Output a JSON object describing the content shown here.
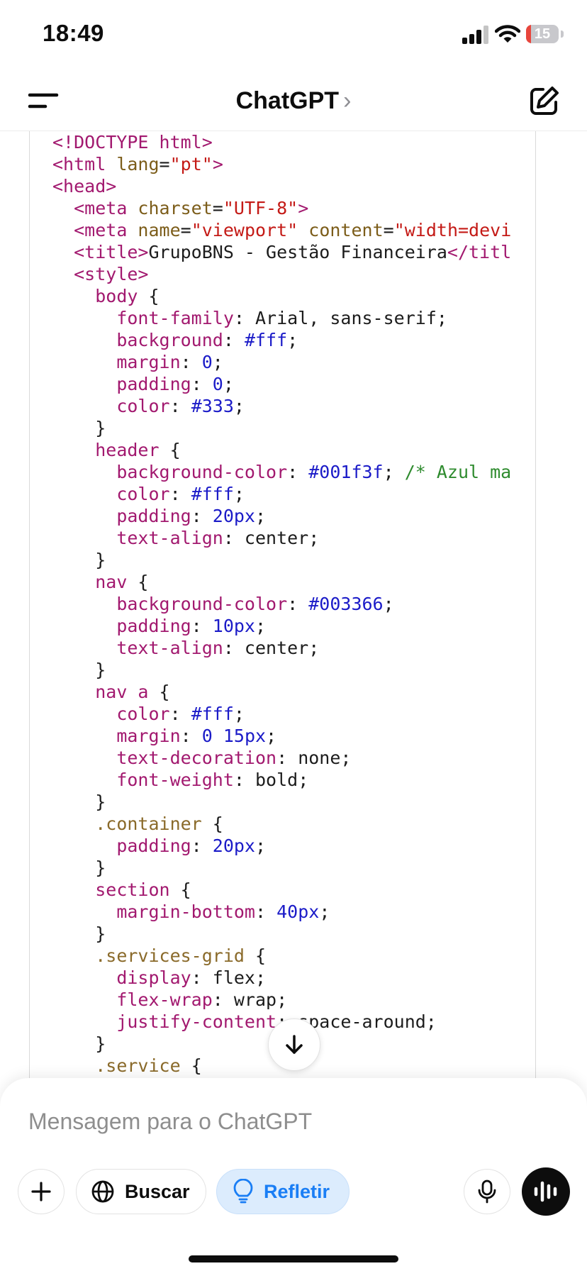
{
  "status_bar": {
    "time": "18:49",
    "battery_percent": "15",
    "battery_level": 0.15,
    "battery_color": "#e8453c",
    "icons": [
      "signal-icon",
      "wifi-icon",
      "battery-icon"
    ]
  },
  "nav": {
    "title": "ChatGPT",
    "title_chevron": "›",
    "icons": [
      "menu-icon",
      "chevron-right-icon",
      "new-chat-icon"
    ]
  },
  "code": {
    "lines": [
      [
        [
          "tag",
          "<!DOCTYPE html>"
        ]
      ],
      [
        [
          "tag",
          "<html "
        ],
        [
          "attr",
          "lang"
        ],
        [
          "plain",
          "="
        ],
        [
          "str",
          "\"pt\""
        ],
        [
          "tag",
          ">"
        ]
      ],
      [
        [
          "tag",
          "<head>"
        ]
      ],
      [
        [
          "plain",
          "  "
        ],
        [
          "tag",
          "<meta "
        ],
        [
          "attr",
          "charset"
        ],
        [
          "plain",
          "="
        ],
        [
          "str",
          "\"UTF-8\""
        ],
        [
          "tag",
          ">"
        ]
      ],
      [
        [
          "plain",
          "  "
        ],
        [
          "tag",
          "<meta "
        ],
        [
          "attr",
          "name"
        ],
        [
          "plain",
          "="
        ],
        [
          "str",
          "\"viewport\""
        ],
        [
          "plain",
          " "
        ],
        [
          "attr",
          "content"
        ],
        [
          "plain",
          "="
        ],
        [
          "str",
          "\"width=devi"
        ]
      ],
      [
        [
          "plain",
          "  "
        ],
        [
          "tag",
          "<title>"
        ],
        [
          "plain",
          "GrupoBNS - Gestão Financeira"
        ],
        [
          "tag",
          "</titl"
        ]
      ],
      [
        [
          "plain",
          "  "
        ],
        [
          "tag",
          "<style>"
        ]
      ],
      [
        [
          "plain",
          "    "
        ],
        [
          "sel",
          "body"
        ],
        [
          "plain",
          " {"
        ]
      ],
      [
        [
          "plain",
          "      "
        ],
        [
          "prop",
          "font-family"
        ],
        [
          "plain",
          ": Arial, sans-serif;"
        ]
      ],
      [
        [
          "plain",
          "      "
        ],
        [
          "prop",
          "background"
        ],
        [
          "plain",
          ": "
        ],
        [
          "num",
          "#fff"
        ],
        [
          "plain",
          ";"
        ]
      ],
      [
        [
          "plain",
          "      "
        ],
        [
          "prop",
          "margin"
        ],
        [
          "plain",
          ": "
        ],
        [
          "num",
          "0"
        ],
        [
          "plain",
          ";"
        ]
      ],
      [
        [
          "plain",
          "      "
        ],
        [
          "prop",
          "padding"
        ],
        [
          "plain",
          ": "
        ],
        [
          "num",
          "0"
        ],
        [
          "plain",
          ";"
        ]
      ],
      [
        [
          "plain",
          "      "
        ],
        [
          "prop",
          "color"
        ],
        [
          "plain",
          ": "
        ],
        [
          "num",
          "#333"
        ],
        [
          "plain",
          ";"
        ]
      ],
      [
        [
          "plain",
          "    }"
        ]
      ],
      [
        [
          "plain",
          "    "
        ],
        [
          "sel",
          "header"
        ],
        [
          "plain",
          " {"
        ]
      ],
      [
        [
          "plain",
          "      "
        ],
        [
          "prop",
          "background-color"
        ],
        [
          "plain",
          ": "
        ],
        [
          "num",
          "#001f3f"
        ],
        [
          "plain",
          "; "
        ],
        [
          "com",
          "/* Azul ma"
        ]
      ],
      [
        [
          "plain",
          "      "
        ],
        [
          "prop",
          "color"
        ],
        [
          "plain",
          ": "
        ],
        [
          "num",
          "#fff"
        ],
        [
          "plain",
          ";"
        ]
      ],
      [
        [
          "plain",
          "      "
        ],
        [
          "prop",
          "padding"
        ],
        [
          "plain",
          ": "
        ],
        [
          "num",
          "20px"
        ],
        [
          "plain",
          ";"
        ]
      ],
      [
        [
          "plain",
          "      "
        ],
        [
          "prop",
          "text-align"
        ],
        [
          "plain",
          ": center;"
        ]
      ],
      [
        [
          "plain",
          "    }"
        ]
      ],
      [
        [
          "plain",
          "    "
        ],
        [
          "sel",
          "nav"
        ],
        [
          "plain",
          " {"
        ]
      ],
      [
        [
          "plain",
          "      "
        ],
        [
          "prop",
          "background-color"
        ],
        [
          "plain",
          ": "
        ],
        [
          "num",
          "#003366"
        ],
        [
          "plain",
          ";"
        ]
      ],
      [
        [
          "plain",
          "      "
        ],
        [
          "prop",
          "padding"
        ],
        [
          "plain",
          ": "
        ],
        [
          "num",
          "10px"
        ],
        [
          "plain",
          ";"
        ]
      ],
      [
        [
          "plain",
          "      "
        ],
        [
          "prop",
          "text-align"
        ],
        [
          "plain",
          ": center;"
        ]
      ],
      [
        [
          "plain",
          "    }"
        ]
      ],
      [
        [
          "plain",
          "    "
        ],
        [
          "sel",
          "nav a"
        ],
        [
          "plain",
          " {"
        ]
      ],
      [
        [
          "plain",
          "      "
        ],
        [
          "prop",
          "color"
        ],
        [
          "plain",
          ": "
        ],
        [
          "num",
          "#fff"
        ],
        [
          "plain",
          ";"
        ]
      ],
      [
        [
          "plain",
          "      "
        ],
        [
          "prop",
          "margin"
        ],
        [
          "plain",
          ": "
        ],
        [
          "num",
          "0 15px"
        ],
        [
          "plain",
          ";"
        ]
      ],
      [
        [
          "plain",
          "      "
        ],
        [
          "prop",
          "text-decoration"
        ],
        [
          "plain",
          ": none;"
        ]
      ],
      [
        [
          "plain",
          "      "
        ],
        [
          "prop",
          "font-weight"
        ],
        [
          "plain",
          ": bold;"
        ]
      ],
      [
        [
          "plain",
          "    }"
        ]
      ],
      [
        [
          "plain",
          "    "
        ],
        [
          "cls",
          ".container"
        ],
        [
          "plain",
          " {"
        ]
      ],
      [
        [
          "plain",
          "      "
        ],
        [
          "prop",
          "padding"
        ],
        [
          "plain",
          ": "
        ],
        [
          "num",
          "20px"
        ],
        [
          "plain",
          ";"
        ]
      ],
      [
        [
          "plain",
          "    }"
        ]
      ],
      [
        [
          "plain",
          "    "
        ],
        [
          "sel",
          "section"
        ],
        [
          "plain",
          " {"
        ]
      ],
      [
        [
          "plain",
          "      "
        ],
        [
          "prop",
          "margin-bottom"
        ],
        [
          "plain",
          ": "
        ],
        [
          "num",
          "40px"
        ],
        [
          "plain",
          ";"
        ]
      ],
      [
        [
          "plain",
          "    }"
        ]
      ],
      [
        [
          "plain",
          "    "
        ],
        [
          "cls",
          ".services-grid"
        ],
        [
          "plain",
          " {"
        ]
      ],
      [
        [
          "plain",
          "      "
        ],
        [
          "prop",
          "display"
        ],
        [
          "plain",
          ": flex;"
        ]
      ],
      [
        [
          "plain",
          "      "
        ],
        [
          "prop",
          "flex-wrap"
        ],
        [
          "plain",
          ": wrap;"
        ]
      ],
      [
        [
          "plain",
          "      "
        ],
        [
          "prop",
          "justify-content"
        ],
        [
          "plain",
          ": space-around;"
        ]
      ],
      [
        [
          "plain",
          "    }"
        ]
      ],
      [
        [
          "plain",
          "    "
        ],
        [
          "cls",
          ".service"
        ],
        [
          "plain",
          " {"
        ]
      ]
    ]
  },
  "composer": {
    "placeholder": "Mensagem para o ChatGPT",
    "search_label": "Buscar",
    "reason_label": "Refletir",
    "reason_active_color": "#1a7ef5",
    "icons": [
      "plus-icon",
      "globe-icon",
      "lightbulb-icon",
      "microphone-icon",
      "voice-mode-icon",
      "arrow-down-icon"
    ]
  }
}
